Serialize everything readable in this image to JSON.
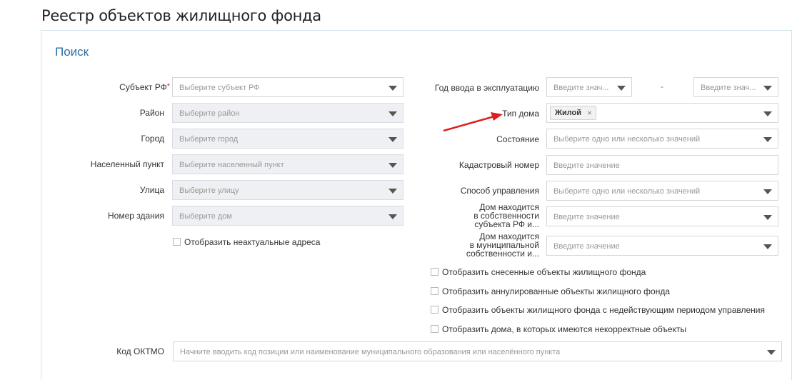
{
  "page": {
    "title": "Реестр объектов жилищного фонда"
  },
  "search": {
    "title": "Поиск",
    "required_mark": "*",
    "left": {
      "subject": {
        "label": "Субъект РФ",
        "placeholder": "Выберите субъект РФ"
      },
      "district": {
        "label": "Район",
        "placeholder": "Выберите район"
      },
      "city": {
        "label": "Город",
        "placeholder": "Выберите город"
      },
      "settlement": {
        "label": "Населенный пункт",
        "placeholder": "Выберите населенный пункт"
      },
      "street": {
        "label": "Улица",
        "placeholder": "Выберите улицу"
      },
      "building": {
        "label": "Номер здания",
        "placeholder": "Выберите дом"
      },
      "show_inactive": "Отобразить неактуальные адреса"
    },
    "right": {
      "year": {
        "label": "Год ввода в эксплуатацию",
        "from_placeholder": "Введите знач...",
        "separator": "-",
        "to_placeholder": "Введите знач..."
      },
      "house_type": {
        "label": "Тип дома",
        "tag": "Жилой",
        "tag_remove": "×"
      },
      "state": {
        "label": "Состояние",
        "placeholder": "Выберите одно или несколько значений"
      },
      "cadastral": {
        "label": "Кадастровый номер",
        "placeholder": "Введите значение"
      },
      "management": {
        "label": "Способ управления",
        "placeholder": "Выберите одно или несколько значений"
      },
      "subject_owned": {
        "label_lines": [
          "Дом находится",
          "в собственности",
          "субъекта РФ и..."
        ],
        "placeholder": "Введите значение"
      },
      "municipal_owned": {
        "label_lines": [
          "Дом находится",
          "в муниципальной",
          "собственности и..."
        ],
        "placeholder": "Введите значение"
      }
    },
    "checkboxes": [
      "Отобразить снесенные объекты жилищного фонда",
      "Отобразить аннулированные объекты жилищного фонда",
      "Отобразить объекты жилищного фонда с недействующим периодом управления",
      "Отобразить дома, в которых имеются некорректные объекты"
    ],
    "oktmo": {
      "label": "Код ОКТМО",
      "placeholder": "Начните вводить код позиции или наименование муниципального образования или населённого пункта"
    }
  },
  "colors": {
    "accent": "#2a6fa5",
    "arrow": "#e02020",
    "disabled_bg": "#eef0f4"
  }
}
